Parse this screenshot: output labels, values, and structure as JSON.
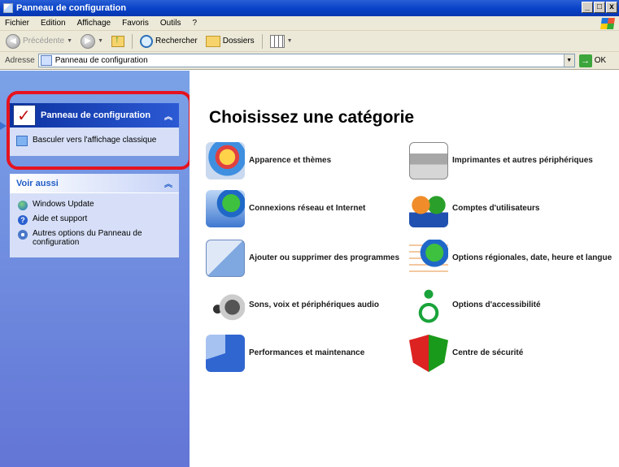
{
  "window": {
    "title": "Panneau de configuration",
    "buttons": {
      "minimize": "_",
      "maximize": "□",
      "close": "x"
    }
  },
  "menubar": {
    "items": [
      "Fichier",
      "Edition",
      "Affichage",
      "Favoris",
      "Outils",
      "?"
    ]
  },
  "toolbar": {
    "back_label": "Précédente",
    "search_label": "Rechercher",
    "folders_label": "Dossiers"
  },
  "address": {
    "label": "Adresse",
    "value": "Panneau de configuration",
    "go_label": "OK"
  },
  "sidebar": {
    "control_panel": {
      "title": "Panneau de configuration",
      "switch_link": "Basculer vers l'affichage classique"
    },
    "see_also": {
      "title": "Voir aussi",
      "links": [
        {
          "label": "Windows Update",
          "icon": "windows-update-icon"
        },
        {
          "label": "Aide et support",
          "icon": "help-icon"
        },
        {
          "label": "Autres options du Panneau de configuration",
          "icon": "options-icon"
        }
      ]
    }
  },
  "main": {
    "heading": "Choisissez une catégorie",
    "categories": [
      {
        "label": "Apparence et thèmes",
        "icon": "appearance-icon"
      },
      {
        "label": "Imprimantes et autres périphériques",
        "icon": "printer-icon"
      },
      {
        "label": "Connexions réseau et Internet",
        "icon": "network-icon"
      },
      {
        "label": "Comptes d'utilisateurs",
        "icon": "user-accounts-icon"
      },
      {
        "label": "Ajouter ou supprimer des programmes",
        "icon": "add-remove-programs-icon"
      },
      {
        "label": "Options régionales, date, heure et langue",
        "icon": "regional-options-icon"
      },
      {
        "label": "Sons, voix et périphériques audio",
        "icon": "sound-icon"
      },
      {
        "label": "Options d'accessibilité",
        "icon": "accessibility-icon"
      },
      {
        "label": "Performances et maintenance",
        "icon": "performance-icon"
      },
      {
        "label": "Centre de sécurité",
        "icon": "security-center-icon"
      }
    ]
  },
  "colors": {
    "titlebar": "#0a44c8",
    "sidebar": "#7ba2e7",
    "highlight": "#e5131f"
  }
}
